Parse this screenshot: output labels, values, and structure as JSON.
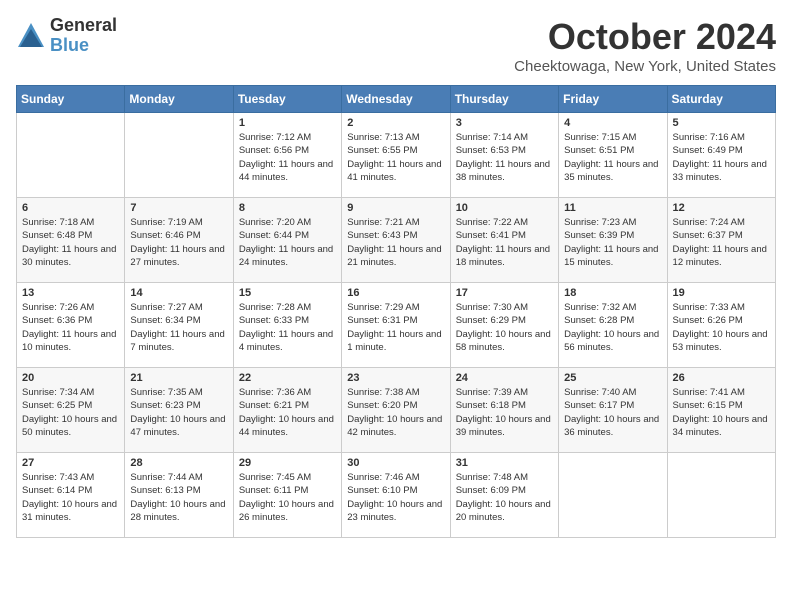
{
  "header": {
    "logo_general": "General",
    "logo_blue": "Blue",
    "month_title": "October 2024",
    "subtitle": "Cheektowaga, New York, United States"
  },
  "days_of_week": [
    "Sunday",
    "Monday",
    "Tuesday",
    "Wednesday",
    "Thursday",
    "Friday",
    "Saturday"
  ],
  "weeks": [
    [
      {
        "day": "",
        "info": ""
      },
      {
        "day": "",
        "info": ""
      },
      {
        "day": "1",
        "info": "Sunrise: 7:12 AM\nSunset: 6:56 PM\nDaylight: 11 hours and 44 minutes."
      },
      {
        "day": "2",
        "info": "Sunrise: 7:13 AM\nSunset: 6:55 PM\nDaylight: 11 hours and 41 minutes."
      },
      {
        "day": "3",
        "info": "Sunrise: 7:14 AM\nSunset: 6:53 PM\nDaylight: 11 hours and 38 minutes."
      },
      {
        "day": "4",
        "info": "Sunrise: 7:15 AM\nSunset: 6:51 PM\nDaylight: 11 hours and 35 minutes."
      },
      {
        "day": "5",
        "info": "Sunrise: 7:16 AM\nSunset: 6:49 PM\nDaylight: 11 hours and 33 minutes."
      }
    ],
    [
      {
        "day": "6",
        "info": "Sunrise: 7:18 AM\nSunset: 6:48 PM\nDaylight: 11 hours and 30 minutes."
      },
      {
        "day": "7",
        "info": "Sunrise: 7:19 AM\nSunset: 6:46 PM\nDaylight: 11 hours and 27 minutes."
      },
      {
        "day": "8",
        "info": "Sunrise: 7:20 AM\nSunset: 6:44 PM\nDaylight: 11 hours and 24 minutes."
      },
      {
        "day": "9",
        "info": "Sunrise: 7:21 AM\nSunset: 6:43 PM\nDaylight: 11 hours and 21 minutes."
      },
      {
        "day": "10",
        "info": "Sunrise: 7:22 AM\nSunset: 6:41 PM\nDaylight: 11 hours and 18 minutes."
      },
      {
        "day": "11",
        "info": "Sunrise: 7:23 AM\nSunset: 6:39 PM\nDaylight: 11 hours and 15 minutes."
      },
      {
        "day": "12",
        "info": "Sunrise: 7:24 AM\nSunset: 6:37 PM\nDaylight: 11 hours and 12 minutes."
      }
    ],
    [
      {
        "day": "13",
        "info": "Sunrise: 7:26 AM\nSunset: 6:36 PM\nDaylight: 11 hours and 10 minutes."
      },
      {
        "day": "14",
        "info": "Sunrise: 7:27 AM\nSunset: 6:34 PM\nDaylight: 11 hours and 7 minutes."
      },
      {
        "day": "15",
        "info": "Sunrise: 7:28 AM\nSunset: 6:33 PM\nDaylight: 11 hours and 4 minutes."
      },
      {
        "day": "16",
        "info": "Sunrise: 7:29 AM\nSunset: 6:31 PM\nDaylight: 11 hours and 1 minute."
      },
      {
        "day": "17",
        "info": "Sunrise: 7:30 AM\nSunset: 6:29 PM\nDaylight: 10 hours and 58 minutes."
      },
      {
        "day": "18",
        "info": "Sunrise: 7:32 AM\nSunset: 6:28 PM\nDaylight: 10 hours and 56 minutes."
      },
      {
        "day": "19",
        "info": "Sunrise: 7:33 AM\nSunset: 6:26 PM\nDaylight: 10 hours and 53 minutes."
      }
    ],
    [
      {
        "day": "20",
        "info": "Sunrise: 7:34 AM\nSunset: 6:25 PM\nDaylight: 10 hours and 50 minutes."
      },
      {
        "day": "21",
        "info": "Sunrise: 7:35 AM\nSunset: 6:23 PM\nDaylight: 10 hours and 47 minutes."
      },
      {
        "day": "22",
        "info": "Sunrise: 7:36 AM\nSunset: 6:21 PM\nDaylight: 10 hours and 44 minutes."
      },
      {
        "day": "23",
        "info": "Sunrise: 7:38 AM\nSunset: 6:20 PM\nDaylight: 10 hours and 42 minutes."
      },
      {
        "day": "24",
        "info": "Sunrise: 7:39 AM\nSunset: 6:18 PM\nDaylight: 10 hours and 39 minutes."
      },
      {
        "day": "25",
        "info": "Sunrise: 7:40 AM\nSunset: 6:17 PM\nDaylight: 10 hours and 36 minutes."
      },
      {
        "day": "26",
        "info": "Sunrise: 7:41 AM\nSunset: 6:15 PM\nDaylight: 10 hours and 34 minutes."
      }
    ],
    [
      {
        "day": "27",
        "info": "Sunrise: 7:43 AM\nSunset: 6:14 PM\nDaylight: 10 hours and 31 minutes."
      },
      {
        "day": "28",
        "info": "Sunrise: 7:44 AM\nSunset: 6:13 PM\nDaylight: 10 hours and 28 minutes."
      },
      {
        "day": "29",
        "info": "Sunrise: 7:45 AM\nSunset: 6:11 PM\nDaylight: 10 hours and 26 minutes."
      },
      {
        "day": "30",
        "info": "Sunrise: 7:46 AM\nSunset: 6:10 PM\nDaylight: 10 hours and 23 minutes."
      },
      {
        "day": "31",
        "info": "Sunrise: 7:48 AM\nSunset: 6:09 PM\nDaylight: 10 hours and 20 minutes."
      },
      {
        "day": "",
        "info": ""
      },
      {
        "day": "",
        "info": ""
      }
    ]
  ]
}
